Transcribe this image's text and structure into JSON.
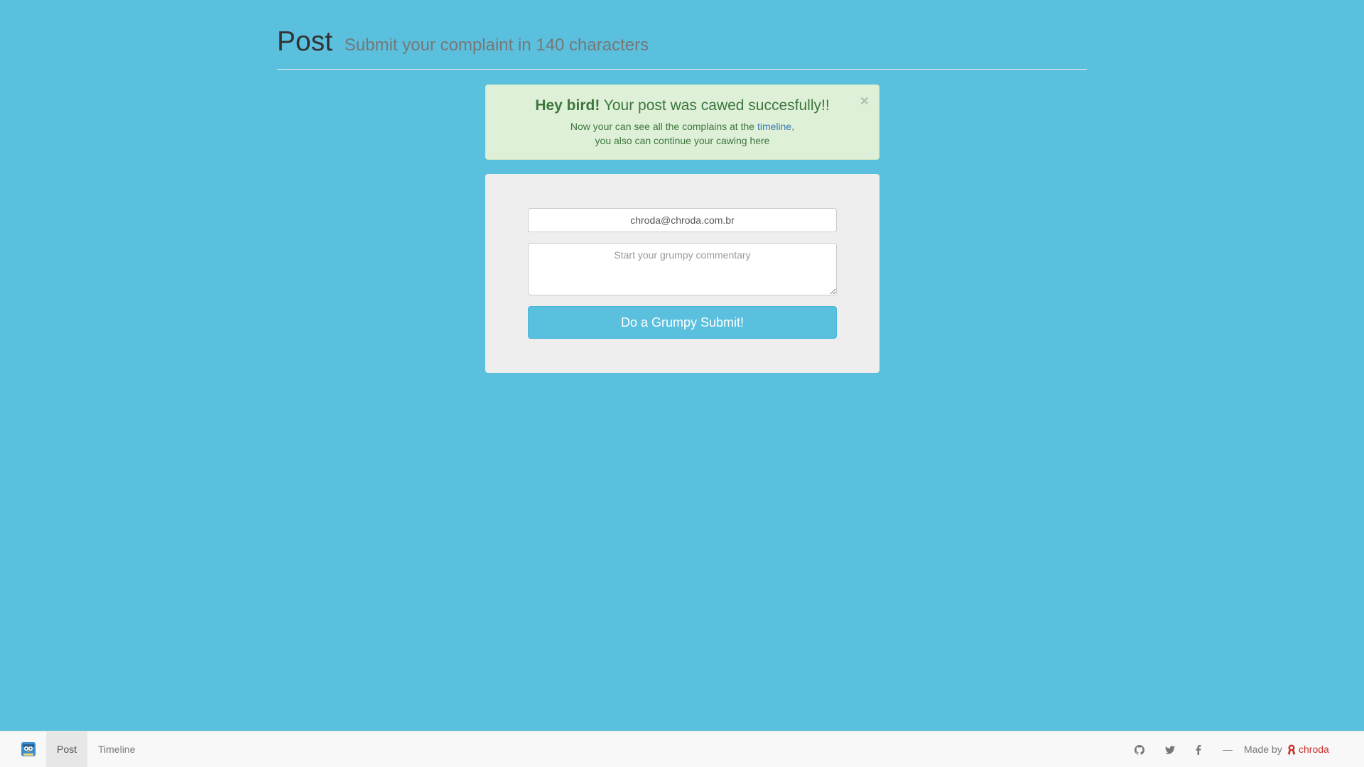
{
  "header": {
    "title": "Post",
    "subtitle": "Submit your complaint in 140 characters"
  },
  "alert": {
    "close_label": "×",
    "heading_strong": "Hey bird!",
    "heading_rest": "Your post was cawed succesfully!!",
    "line1_prefix": "Now your can see all the complains at the",
    "line1_link": "timeline",
    "line1_suffix": ",",
    "line2": "you also can continue your cawing here"
  },
  "form": {
    "email_value": "chroda@chroda.com.br",
    "comment_placeholder": "Start your grumpy commentary",
    "submit_label": "Do a Grumpy Submit!"
  },
  "navbar": {
    "items": [
      {
        "label": "Post",
        "active": true
      },
      {
        "label": "Timeline",
        "active": false
      }
    ],
    "social_icons": [
      "github-icon",
      "twitter-icon",
      "facebook-icon"
    ],
    "separator": "—",
    "made_by_label": "Made by",
    "author": "chroda"
  },
  "colors": {
    "background": "#5bc0de",
    "alert_bg": "#dff0d8",
    "alert_text": "#3c763d",
    "button": "#5bc0de",
    "author": "#c9302c"
  }
}
